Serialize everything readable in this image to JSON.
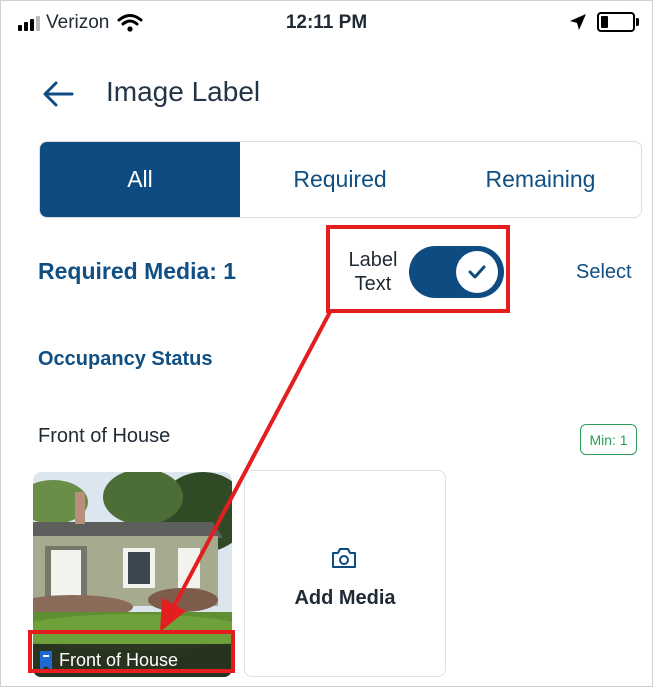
{
  "status_bar": {
    "carrier": "Verizon",
    "time": "12:11 PM"
  },
  "header": {
    "title": "Image Label"
  },
  "tabs": [
    {
      "label": "All",
      "active": true
    },
    {
      "label": "Required",
      "active": false
    },
    {
      "label": "Remaining",
      "active": false
    }
  ],
  "required": {
    "label": "Required Media: 1",
    "toggle_label_line1": "Label",
    "toggle_label_line2": "Text",
    "toggle_on": true,
    "select_label": "Select"
  },
  "sections": {
    "occupancy": "Occupancy Status",
    "front": "Front of House",
    "min_badge": "Min: 1"
  },
  "media": {
    "photo_caption": "Front of House",
    "add_label": "Add Media"
  },
  "colors": {
    "primary": "#0e4b80",
    "highlight": "#e41e1e",
    "badge_green": "#2e9d5a"
  }
}
